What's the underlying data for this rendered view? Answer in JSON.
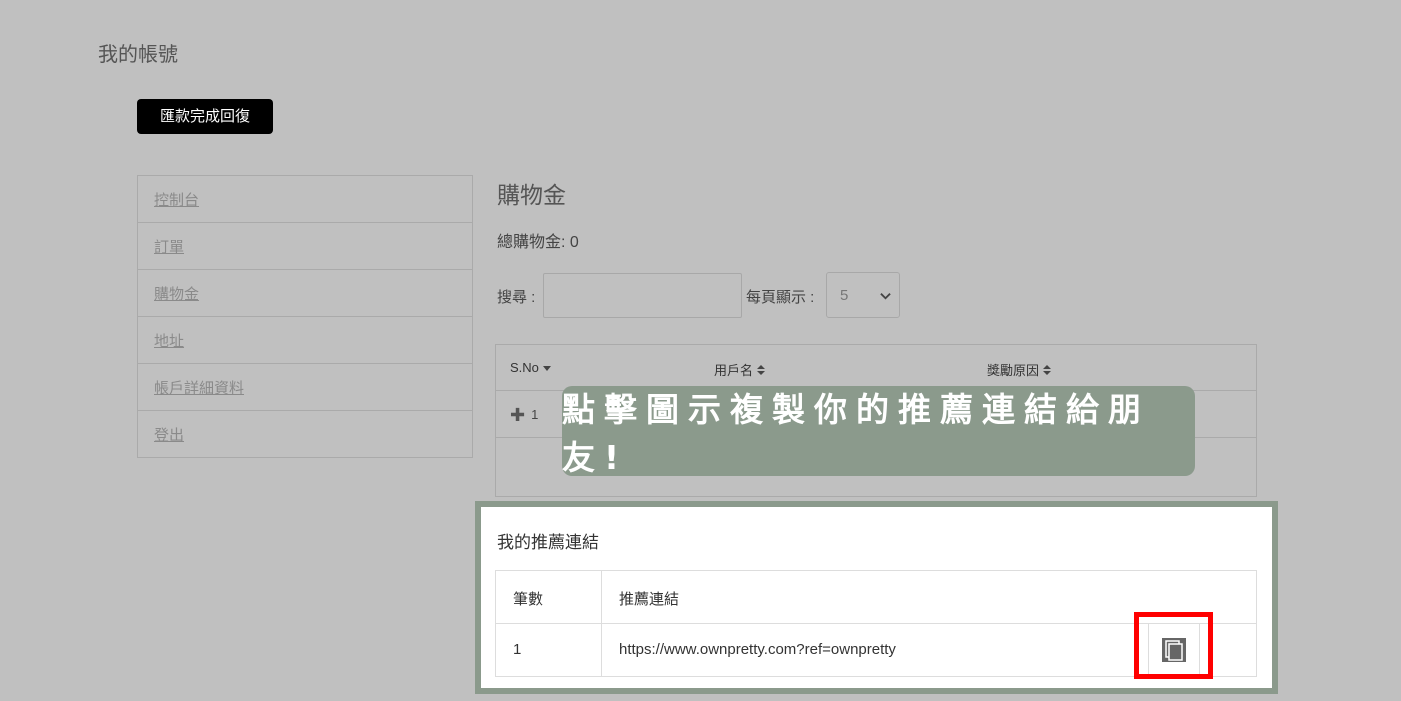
{
  "page_title": "我的帳號",
  "top_button": "匯款完成回復",
  "sidebar": {
    "items": [
      {
        "label": "控制台"
      },
      {
        "label": "訂單"
      },
      {
        "label": "購物金"
      },
      {
        "label": "地址"
      },
      {
        "label": "帳戶詳細資料"
      },
      {
        "label": "登出"
      }
    ]
  },
  "main": {
    "title": "購物金",
    "total_label": "總購物金: 0",
    "search_label": "搜尋 :",
    "search_value": "",
    "perpage_label": "每頁顯示 :",
    "perpage_value": "5",
    "table": {
      "headers": [
        "S.No",
        "用戶名",
        "獎勵原因"
      ],
      "rows": [
        {
          "sno": "1"
        }
      ]
    }
  },
  "overlay_text": "點擊圖示複製你的推薦連結給朋友!",
  "referral": {
    "title": "我的推薦連結",
    "headers": [
      "筆數",
      "推薦連結"
    ],
    "rows": [
      {
        "index": "1",
        "link": "https://www.ownpretty.com?ref=ownpretty"
      }
    ]
  },
  "colors": {
    "background": "#c0c0c0",
    "overlay": "#8b9a8c",
    "highlight": "#ff0000",
    "button": "#000000"
  },
  "icons": [
    "sort-caret-down-icon",
    "sort-icon",
    "plus-icon",
    "chevron-down-icon",
    "copy-icon"
  ]
}
